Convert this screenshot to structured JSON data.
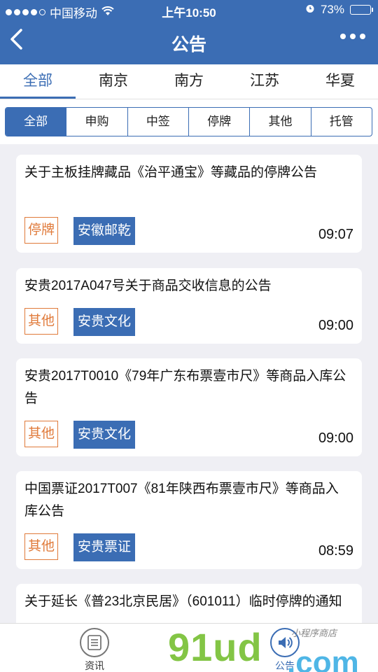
{
  "status_bar": {
    "carrier": "中国移动",
    "time": "上午10:50",
    "battery_pct": "73%",
    "battery_level": 0.73
  },
  "nav": {
    "title": "公告"
  },
  "category_tabs": [
    "全部",
    "南京",
    "南方",
    "江苏",
    "华夏"
  ],
  "active_category": "全部",
  "filter_segments": [
    "全部",
    "申购",
    "中签",
    "停牌",
    "其他",
    "托管"
  ],
  "active_segment": "全部",
  "announcements": [
    {
      "title": "关于主板挂牌藏品《治平通宝》等藏品的停牌公告",
      "type": "停牌",
      "company": "安徽邮乾",
      "time": "09:07"
    },
    {
      "title": "安贵2017A047号关于商品交收信息的公告",
      "type": "其他",
      "company": "安贵文化",
      "time": "09:00"
    },
    {
      "title": "安贵2017T0010《79年广东布票壹市尺》等商品入库公告",
      "type": "其他",
      "company": "安贵文化",
      "time": "09:00"
    },
    {
      "title": "中国票证2017T007《81年陕西布票壹市尺》等商品入库公告",
      "type": "其他",
      "company": "安贵票证",
      "time": "08:59"
    },
    {
      "title": "关于延长《普23北京民居》（601011）临时停牌的通知",
      "type": "",
      "company": "",
      "time": ""
    }
  ],
  "bottom_tabs": [
    {
      "label": "资讯",
      "icon": "news-list-icon"
    },
    {
      "label": "公告",
      "icon": "speaker-icon"
    }
  ],
  "watermark": {
    "main": "91ud",
    "suffix": ".com",
    "small": "小程序商店"
  },
  "colors": {
    "primary": "#3b6db4",
    "tag_orange": "#e07a3a",
    "background": "#efeff4"
  }
}
